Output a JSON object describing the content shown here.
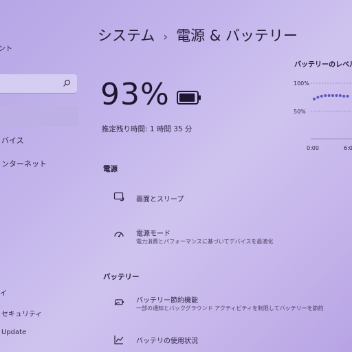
{
  "sidebar": {
    "account_fragment": "ント",
    "search_placeholder": "",
    "items": [
      {
        "label": "バイス"
      },
      {
        "label": "ンターネット"
      },
      {
        "label": "イ"
      },
      {
        "label": "セキュリティ"
      },
      {
        "label": "Update"
      }
    ]
  },
  "header": {
    "section": "システム",
    "separator": "›",
    "page": "電源 & バッテリー"
  },
  "battery": {
    "percent_text": "93%",
    "level": 0.93,
    "estimate": "推定残り時間: 1 時間 35 分"
  },
  "power": {
    "heading": "電源",
    "items": [
      {
        "title": "画面とスリープ",
        "subtitle": "",
        "icon": "screen-sleep-icon"
      },
      {
        "title": "電源モード",
        "subtitle": "電力消費とパフォーマンスに基づいてデバイスを最適化",
        "icon": "power-mode-icon"
      }
    ]
  },
  "battery_section": {
    "heading": "バッテリー",
    "items": [
      {
        "title": "バッテリー節約機能",
        "subtitle": "一部の通知とバックグラウンド アクティビティを制限してバッテリーを節約",
        "icon": "battery-saver-icon"
      },
      {
        "title": "バッテリの使用状況",
        "subtitle": "",
        "icon": "usage-chart-icon"
      }
    ]
  },
  "chart_data": {
    "type": "scatter",
    "title": "バッテリーのレベル",
    "y_ticks": [
      "100%",
      "50%"
    ],
    "x_ticks": [
      "0:00",
      "6:0"
    ],
    "ylim": [
      0,
      100
    ],
    "x": [
      0,
      0.6,
      1.2,
      1.8,
      2.4,
      3.0,
      3.6,
      4.2,
      4.8,
      5.4
    ],
    "values": [
      72,
      75,
      77,
      78,
      78,
      78,
      78,
      78,
      77,
      77
    ],
    "grid": true
  },
  "colors": {
    "accent": "#5a57b8",
    "text": "#26203a"
  }
}
